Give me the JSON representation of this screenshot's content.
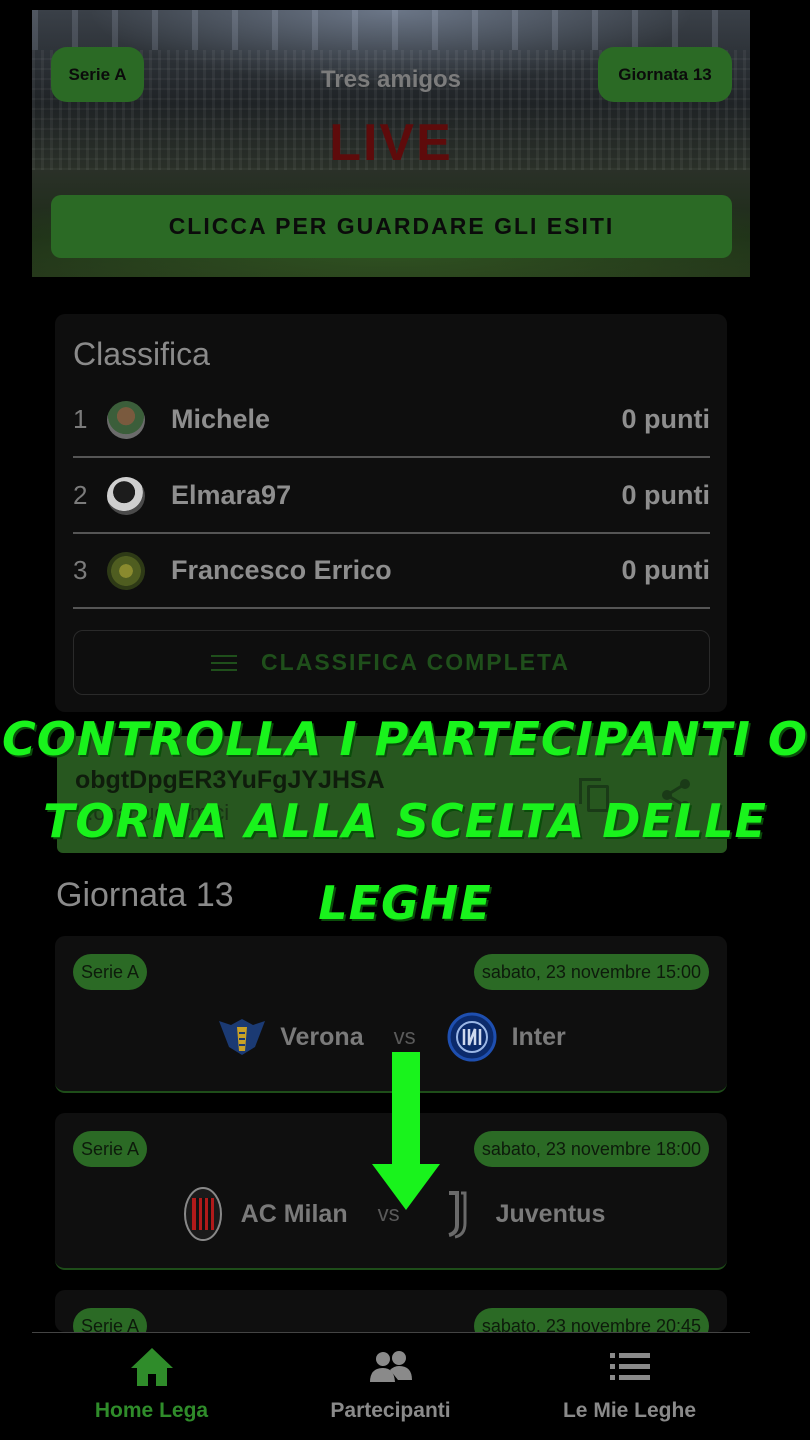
{
  "header": {
    "league_pill": "Serie A",
    "round_pill": "Giornata 13",
    "league_name": "Tres amigos",
    "live_label": "LIVE",
    "results_button": "CLICCA PER GUARDARE GLI ESITI"
  },
  "standings": {
    "title": "Classifica",
    "rows": [
      {
        "position": "1",
        "name": "Michele",
        "points": "0 punti"
      },
      {
        "position": "2",
        "name": "Elmara97",
        "points": "0 punti"
      },
      {
        "position": "3",
        "name": "Francesco Errico",
        "points": "0 punti"
      }
    ],
    "full_button": "CLASSIFICA COMPLETA"
  },
  "invite": {
    "code": "obgtDpgER3YuFgJYJHSA",
    "subtitle": "...ona tuoi amici"
  },
  "round": {
    "title": "Giornata 13",
    "matches": [
      {
        "league": "Serie A",
        "date": "sabato, 23 novembre 15:00",
        "home": "Verona",
        "vs": "vs",
        "away": "Inter"
      },
      {
        "league": "Serie A",
        "date": "sabato, 23 novembre 18:00",
        "home": "AC Milan",
        "vs": "vs",
        "away": "Juventus"
      },
      {
        "league": "Serie A",
        "date": "sabato, 23 novembre 20:45"
      }
    ]
  },
  "overlay": {
    "line1": "CONTROLLA I PARTECIPANTI O",
    "line2": "TORNA ALLA SCELTA DELLE",
    "line3": "LEGHE"
  },
  "nav": [
    {
      "label": "Home Lega",
      "icon": "home-icon"
    },
    {
      "label": "Partecipanti",
      "icon": "users-icon"
    },
    {
      "label": "Le Mie Leghe",
      "icon": "list-icon"
    }
  ],
  "colors": {
    "accent_green": "#2b6a25",
    "overlay_green": "#19f31c",
    "live_red": "#5e0b0b",
    "active_nav": "#2f8c2a"
  }
}
